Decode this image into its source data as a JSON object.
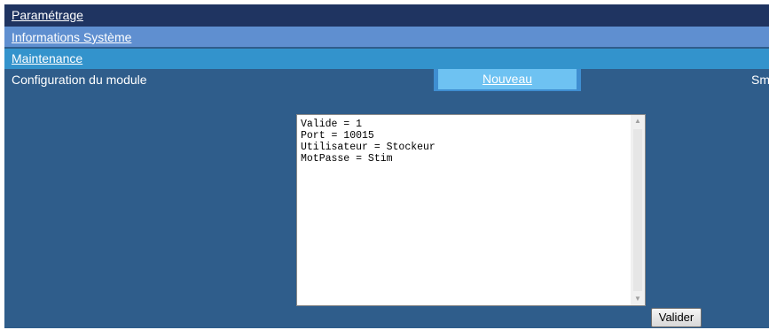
{
  "nav": {
    "parametrage": "Paramétrage",
    "informations_systeme": "Informations Système",
    "maintenance": "Maintenance"
  },
  "config": {
    "label": "Configuration du module",
    "tab_nouveau": "Nouveau",
    "tab_smtp": "Smtp"
  },
  "editor": {
    "content": "Valide = 1\nPort = 10015\nUtilisateur = Stockeur\nMotPasse = Stim"
  },
  "buttons": {
    "valider": "Valider"
  },
  "colors": {
    "page_bg": "#2f5d8b",
    "nav_parametrage_bg": "#1f3461",
    "nav_info_bg": "#5f8fd0",
    "nav_maintenance_bg": "#3393cc",
    "tab_active_bg": "#6ec2f2"
  }
}
